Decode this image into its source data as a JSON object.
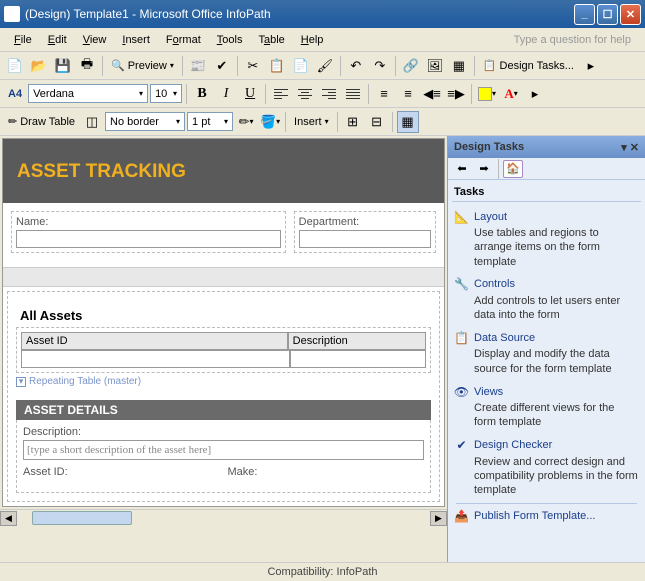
{
  "titlebar": {
    "icon": "infopath-icon",
    "text": "(Design) Template1 - Microsoft Office InfoPath"
  },
  "menubar": {
    "items": [
      "File",
      "Edit",
      "View",
      "Insert",
      "Format",
      "Tools",
      "Table",
      "Help"
    ],
    "help_prompt": "Type a question for help"
  },
  "toolbar1": {
    "preview_label": "Preview",
    "design_tasks_label": "Design Tasks..."
  },
  "toolbar2": {
    "font_indicator": "A4",
    "font_name": "Verdana",
    "font_size": "10"
  },
  "toolbar3": {
    "draw_table_label": "Draw Table",
    "border_style": "No border",
    "border_width": "1 pt",
    "insert_label": "Insert"
  },
  "canvas": {
    "banner_title": "ASSET TRACKING",
    "name_label": "Name:",
    "department_label": "Department:",
    "all_assets_title": "All Assets",
    "col_asset_id": "Asset ID",
    "col_description": "Description",
    "repeating_hint": "Repeating Table (master)",
    "details_title": "ASSET DETAILS",
    "desc_label": "Description:",
    "desc_placeholder": "[type a short description of the asset here]",
    "detail_asset_id": "Asset ID:",
    "detail_make": "Make:"
  },
  "task_pane": {
    "title": "Design Tasks",
    "section_title": "Tasks",
    "items": [
      {
        "icon": "📐",
        "label": "Layout",
        "desc": "Use tables and regions to arrange items on the form template"
      },
      {
        "icon": "🔧",
        "label": "Controls",
        "desc": "Add controls to let users enter data into the form"
      },
      {
        "icon": "📋",
        "label": "Data Source",
        "desc": "Display and modify the data source for the form template"
      },
      {
        "icon": "👁",
        "label": "Views",
        "desc": "Create different views for the form template"
      },
      {
        "icon": "✔",
        "label": "Design Checker",
        "desc": "Review and correct design and compatibility problems in the form template"
      },
      {
        "icon": "📤",
        "label": "Publish Form Template...",
        "desc": ""
      }
    ]
  },
  "statusbar": {
    "text": "Compatibility: InfoPath"
  }
}
